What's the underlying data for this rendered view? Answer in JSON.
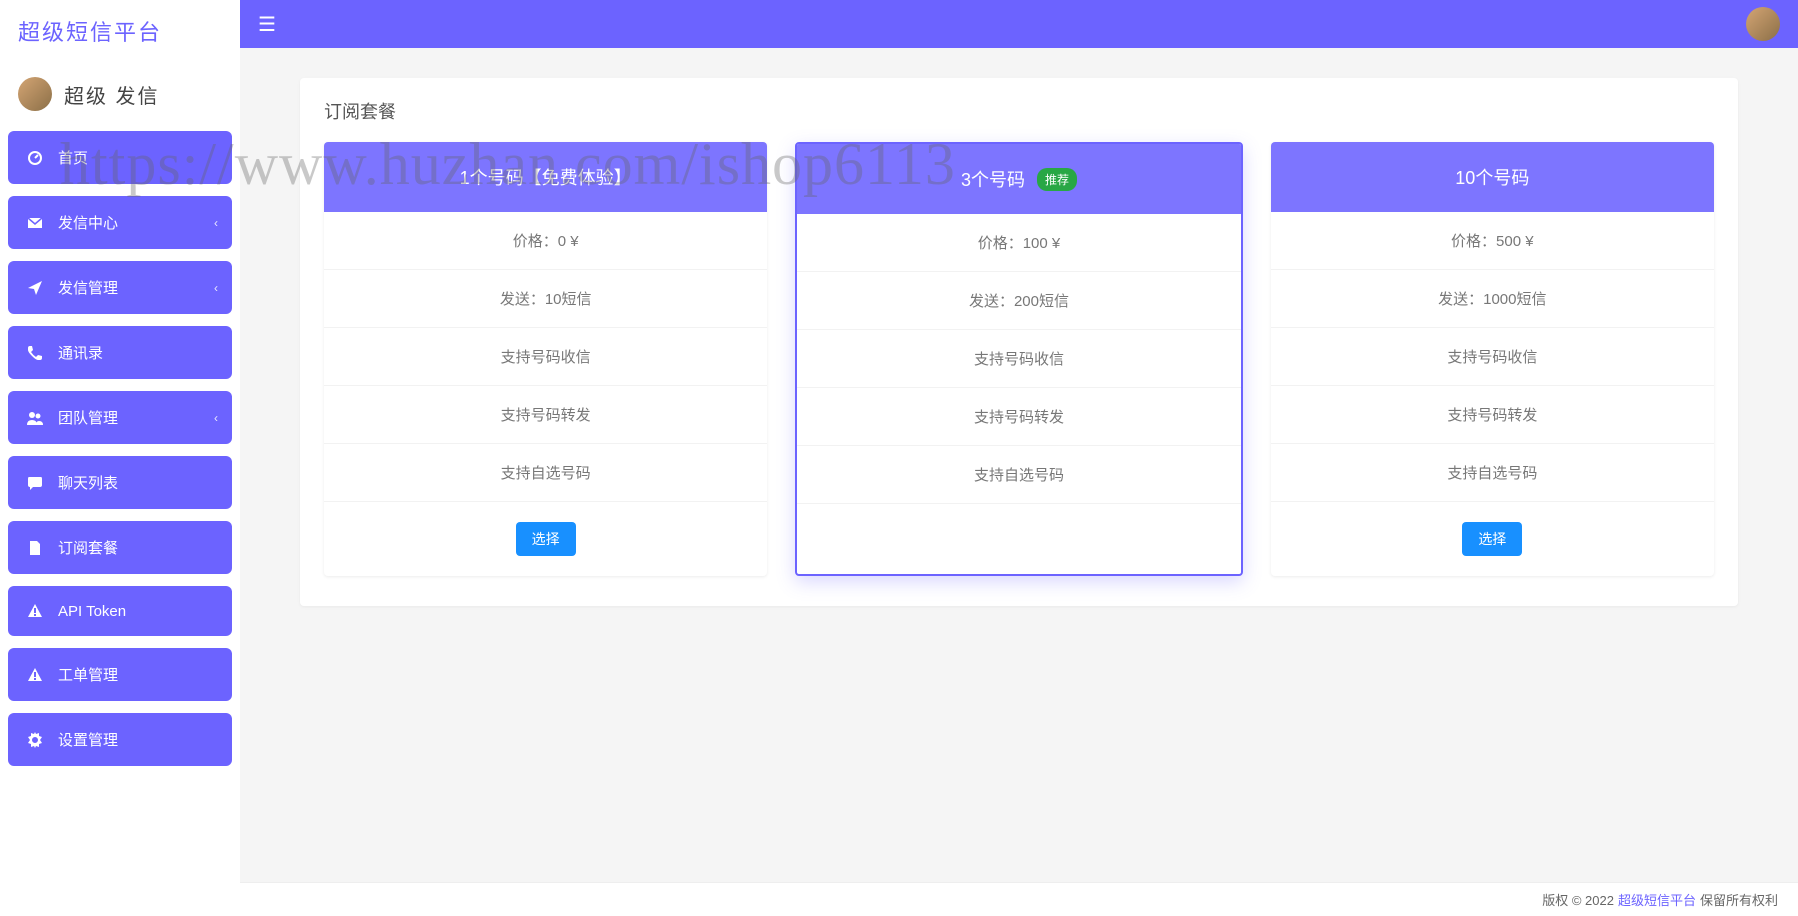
{
  "brand": "超级短信平台",
  "user": {
    "name": "超级 发信"
  },
  "nav": [
    {
      "icon": "dashboard",
      "label": "首页",
      "expandable": false
    },
    {
      "icon": "envelope",
      "label": "发信中心",
      "expandable": true
    },
    {
      "icon": "send",
      "label": "发信管理",
      "expandable": true
    },
    {
      "icon": "phone",
      "label": "通讯录",
      "expandable": false
    },
    {
      "icon": "users",
      "label": "团队管理",
      "expandable": true
    },
    {
      "icon": "chat",
      "label": "聊天列表",
      "expandable": false
    },
    {
      "icon": "file",
      "label": "订阅套餐",
      "expandable": false
    },
    {
      "icon": "warning",
      "label": "API Token",
      "expandable": false
    },
    {
      "icon": "warning",
      "label": "工单管理",
      "expandable": false
    },
    {
      "icon": "gear",
      "label": "设置管理",
      "expandable": false
    }
  ],
  "page": {
    "title": "订阅套餐"
  },
  "plans": [
    {
      "title": "1个号码【免费体验】",
      "badge": "",
      "featured": false,
      "price": "价格：0 ¥",
      "send": "发送：10短信",
      "f1": "支持号码收信",
      "f2": "支持号码转发",
      "f3": "支持自选号码",
      "button": "选择"
    },
    {
      "title": "3个号码",
      "badge": "推荐",
      "featured": true,
      "price": "价格：100 ¥",
      "send": "发送：200短信",
      "f1": "支持号码收信",
      "f2": "支持号码转发",
      "f3": "支持自选号码",
      "button": ""
    },
    {
      "title": "10个号码",
      "badge": "",
      "featured": false,
      "price": "价格：500 ¥",
      "send": "发送：1000短信",
      "f1": "支持号码收信",
      "f2": "支持号码转发",
      "f3": "支持自选号码",
      "button": "选择"
    }
  ],
  "footer": {
    "copyright_prefix": "版权 © 2022",
    "link": "超级短信平台",
    "copyright_suffix": "保留所有权利"
  },
  "watermark": "https://www.huzhan.com/ishop6113"
}
